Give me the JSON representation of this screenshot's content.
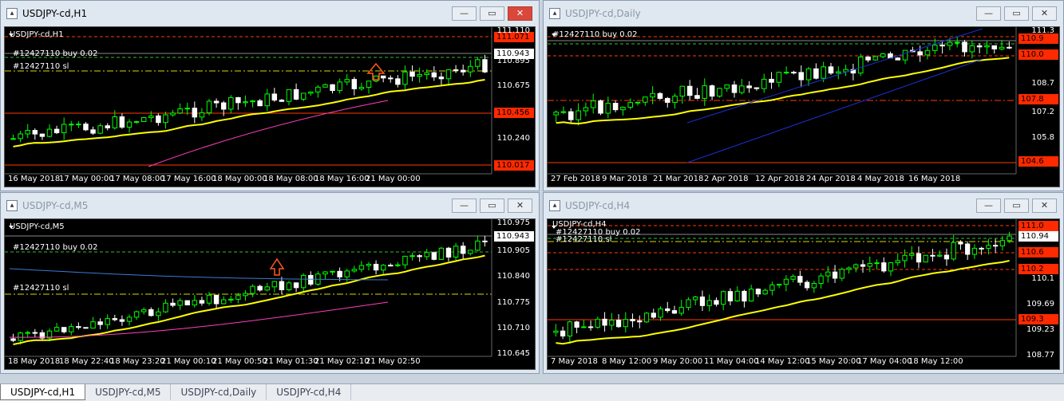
{
  "tabs": [
    {
      "label": "USDJPY-cd,H1",
      "active": true
    },
    {
      "label": "USDJPY-cd,M5",
      "active": false
    },
    {
      "label": "USDJPY-cd,Daily",
      "active": false
    },
    {
      "label": "USDJPY-cd,H4",
      "active": false
    }
  ],
  "windows": {
    "h1": {
      "title": "USDJPY-cd,H1",
      "chart_label": "USDJPY-cd,H1",
      "order_label": "#12427110 buy 0.02",
      "sl_label": "#12427110 sl",
      "price_red": [
        "111.071",
        "110.456",
        "110.017"
      ],
      "price_current": "110.943",
      "axis": [
        "111.110",
        "110.895",
        "110.675",
        "110.240"
      ],
      "time": [
        "16 May 2018",
        "17 May 00:00",
        "17 May 08:00",
        "17 May 16:00",
        "18 May 00:00",
        "18 May 08:00",
        "18 May 16:00",
        "21 May 00:00"
      ]
    },
    "daily": {
      "title": "USDJPY-cd,Daily",
      "chart_label": "#12427110 buy 0.02",
      "price_red": [
        "110.9",
        "110.0",
        "107.8",
        "104.6"
      ],
      "axis": [
        "111.3",
        "108.7",
        "107.2",
        "105.8"
      ],
      "time": [
        "27 Feb 2018",
        "9 Mar 2018",
        "21 Mar 2018",
        "2 Apr 2018",
        "12 Apr 2018",
        "24 Apr 2018",
        "4 May 2018",
        "16 May 2018"
      ]
    },
    "m5": {
      "title": "USDJPY-cd,M5",
      "chart_label": "USDJPY-cd,M5",
      "order_label": "#12427110 buy 0.02",
      "sl_label": "#12427110 sl",
      "price_current": "110.943",
      "axis": [
        "110.975",
        "110.905",
        "110.840",
        "110.775",
        "110.710",
        "110.645"
      ],
      "time": [
        "18 May 2018",
        "18 May 22:40",
        "18 May 23:20",
        "21 May 00:10",
        "21 May 00:50",
        "21 May 01:30",
        "21 May 02:10",
        "21 May 02:50"
      ]
    },
    "h4": {
      "title": "USDJPY-cd,H4",
      "chart_label": "USDJPY-cd,H4",
      "order_label": "#12427110 buy 0.02",
      "sl_label": "#12427110 sl",
      "price_red": [
        "111.0",
        "110.6",
        "110.2",
        "109.3"
      ],
      "price_current": "110.94",
      "axis": [
        "110.1",
        "109.69",
        "109.23",
        "108.77"
      ],
      "time": [
        "7 May 2018",
        "8 May 12:00",
        "9 May 20:00",
        "11 May 04:00",
        "14 May 12:00",
        "15 May 20:00",
        "17 May 04:00",
        "18 May 12:00"
      ]
    }
  },
  "window_buttons": {
    "min": "—",
    "max": "▭",
    "close": "✕"
  },
  "colors": {
    "bull": "#00ff00",
    "bear": "#ffffff",
    "ma_fast": "#ffff00",
    "ma_slow": "#ff3fbf",
    "ma_blue": "#3a7bd5",
    "level_red": "#ff3b00",
    "order_green": "#2fbf2f",
    "sl_yellow": "#d8d800"
  }
}
